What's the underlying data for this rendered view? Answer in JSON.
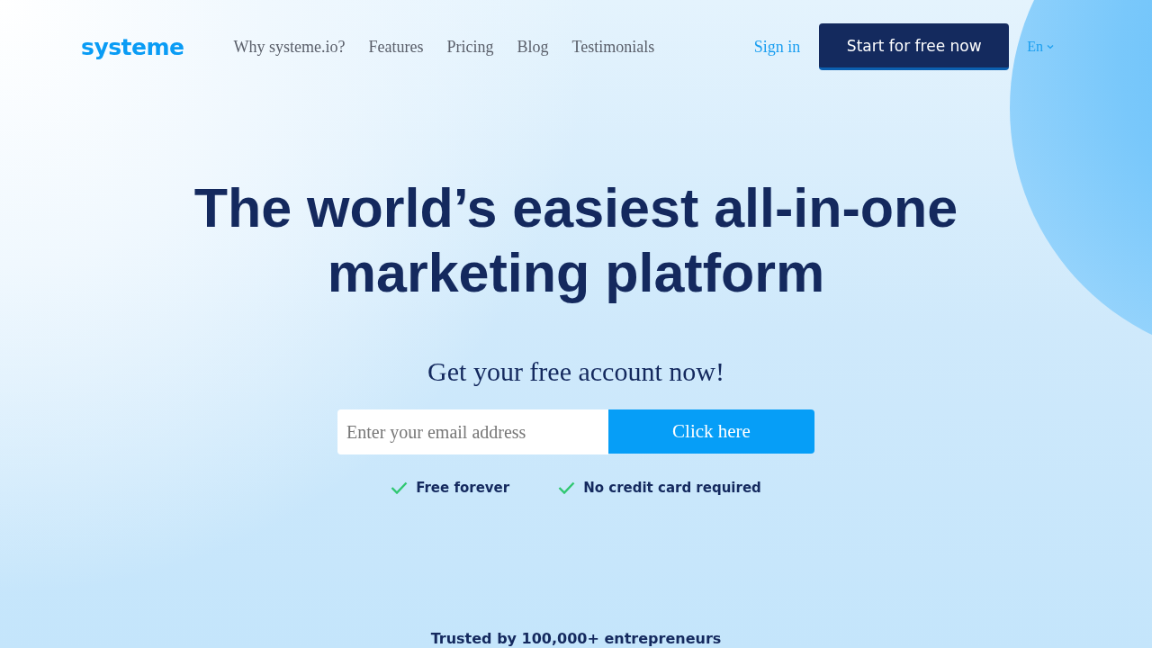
{
  "header": {
    "logo": "systeme",
    "nav": [
      "Why systeme.io?",
      "Features",
      "Pricing",
      "Blog",
      "Testimonials"
    ],
    "sign_in": "Sign in",
    "cta_button": "Start for free now",
    "language": "En"
  },
  "hero": {
    "headline": [
      "The world’s easiest all-in-one",
      "marketing platform"
    ],
    "signup": {
      "heading": "Get your free account now!",
      "email_placeholder": "Enter your email address",
      "button": "Click here"
    },
    "benefits": [
      "Free forever",
      "No credit card required"
    ],
    "trusted": "Trusted by 100,000+ entrepreneurs"
  }
}
